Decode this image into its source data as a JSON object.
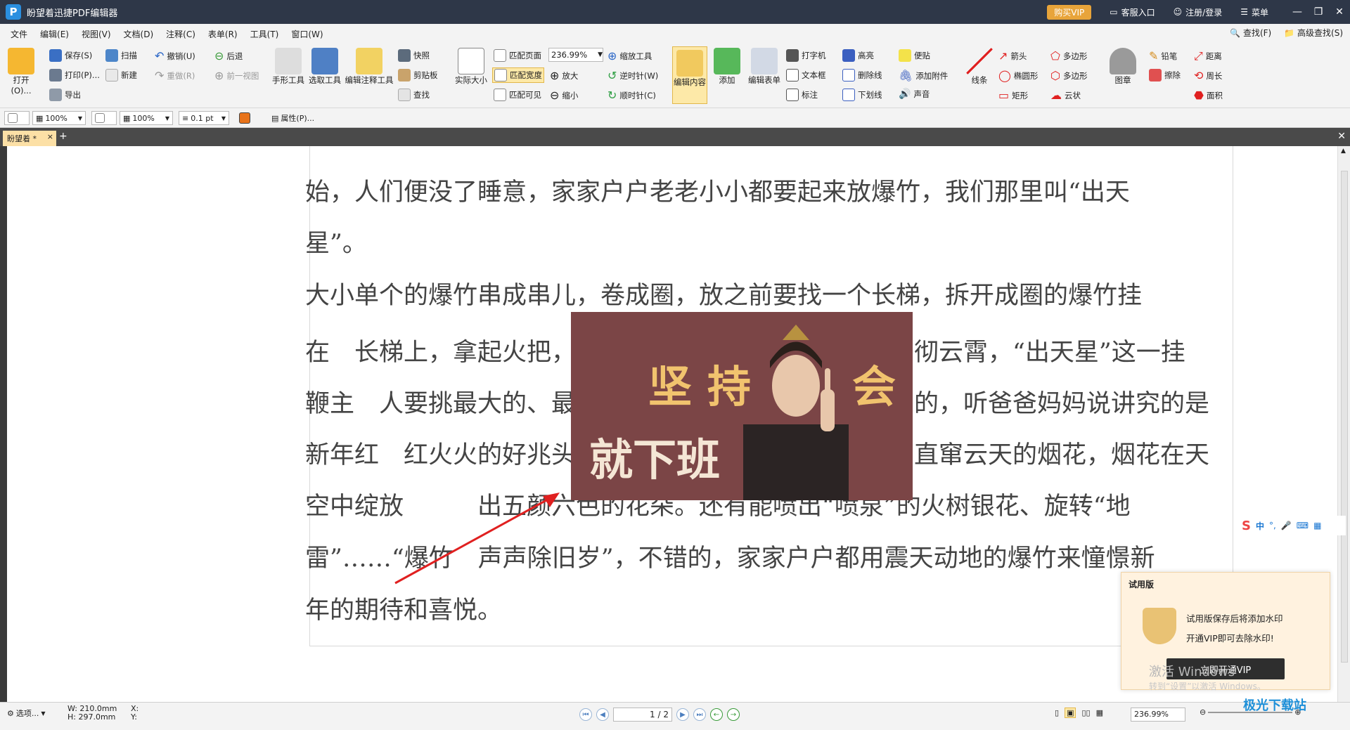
{
  "titlebar": {
    "title": "盼望着迅捷PDF编辑器",
    "vip": "购买VIP",
    "service": "客服入口",
    "login": "注册/登录",
    "menu": "菜单"
  },
  "menubar": {
    "items": [
      "文件",
      "编辑(E)",
      "视图(V)",
      "文档(D)",
      "注释(C)",
      "表单(R)",
      "工具(T)",
      "窗口(W)"
    ],
    "find": "查找(F)",
    "advfind": "高级查找(S)"
  },
  "ribbon": {
    "open": "打开(O)...",
    "save": "保存(S)",
    "print": "打印(P)...",
    "export": "导出",
    "scan": "扫描",
    "new": "新建",
    "undo": "撤销(U)",
    "redo": "重做(R)",
    "back": "后退",
    "prevview": "前一视图",
    "hand": "手形工具",
    "select": "选取工具",
    "editannot": "编辑注释工具",
    "snapshot": "快照",
    "clipboard": "剪贴板",
    "find": "查找",
    "actual": "实际大小",
    "fitpage": "匹配页面",
    "fitwidth": "匹配宽度",
    "fitvisible": "匹配可见",
    "zoom": "236.99%",
    "zoomin": "放大",
    "zoomout": "缩小",
    "zoomtool": "缩放工具",
    "ccw": "逆时针(W)",
    "cw": "顺时针(C)",
    "editcontent": "编辑内容",
    "add": "添加",
    "editform": "编辑表单",
    "typewriter": "打字机",
    "textbox": "文本框",
    "mark": "标注",
    "highlight": "高亮",
    "strike": "删除线",
    "underline": "下划线",
    "note": "便贴",
    "attach": "添加附件",
    "sound": "声音",
    "line": "线条",
    "arrow": "箭头",
    "ellipse": "椭圆形",
    "rect": "矩形",
    "polygon": "多边形",
    "polyline": "多边形",
    "cloud": "云状",
    "stamp": "图章",
    "pencil": "铅笔",
    "eraser": "擦除",
    "distance": "距离",
    "perimeter": "周长",
    "area": "面积"
  },
  "propbar": {
    "opacity1": "100%",
    "opacity2": "100%",
    "width": "0.1 pt",
    "props": "属性(P)..."
  },
  "tab": {
    "name": "盼望着 *"
  },
  "doc": {
    "lines": [
      "始，人们便没了睡意，家家户户老老小小都要起来放爆竹，我们那里叫“出天",
      "星”。",
      "大小单个的爆竹串成串儿，卷成圈，放之前要找一个长梯，拆开成圈的爆竹挂",
      "在　长梯上，拿起火把，",
      "彻云霄，“出天星”这一挂",
      "鞭主　人要挑最大的、最",
      "的，听爸爸妈妈说讲究的是",
      "新年红　红火火的好兆头",
      "直窜云天的烟花，烟花在天",
      "空中绽放　　　出五颜六色的花朵。还有能喷出“喷泉”的火树银花、旋转“地",
      "雷”……“爆竹　声声除旧岁”，不错的，家家户户都用震天动地的爆竹来憧憬新",
      "年的期待和喜悦。"
    ]
  },
  "overlay": {
    "t1": "坚持",
    "t2": "会",
    "t3": "就下班"
  },
  "trial": {
    "title": "试用版",
    "line1": "试用版保存后将添加水印",
    "line2": "开通VIP即可去除水印!",
    "button": "立即开通VIP"
  },
  "watermark": {
    "l1": "激活 Windows",
    "l2": "转到“设置”以激活 Windows。"
  },
  "ime": {
    "lang": "中"
  },
  "status": {
    "select": "选项...",
    "w": "W: 210.0mm",
    "h": "H: 297.0mm",
    "x": "X:",
    "y": "Y:",
    "page": "1 / 2",
    "zoom": "236.99%"
  },
  "site": "极光下载站",
  "colors": {
    "titlebar": "#2e3748",
    "overlay": "#7b4546",
    "accent": "#f1c36e",
    "vip": "#e8a43a",
    "arrow": "#e02020"
  }
}
